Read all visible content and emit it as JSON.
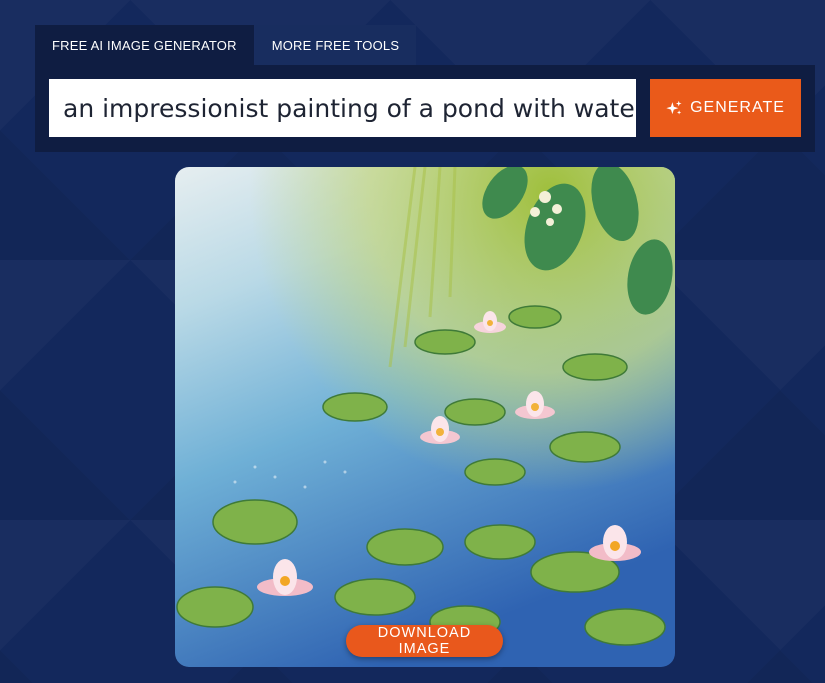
{
  "tabs": [
    {
      "label": "FREE AI IMAGE GENERATOR",
      "active": true
    },
    {
      "label": "MORE FREE TOOLS",
      "active": false
    }
  ],
  "prompt": {
    "value": "an impressionist painting of a pond with water"
  },
  "generate_button": {
    "label": "GENERATE",
    "icon": "sparkle-icon",
    "color": "#ea5a1a"
  },
  "result_image": {
    "download_label": "DOWNLOAD IMAGE"
  },
  "colors": {
    "background": "#13285c",
    "panel": "#0f1d42",
    "accent": "#ea5a1a"
  }
}
